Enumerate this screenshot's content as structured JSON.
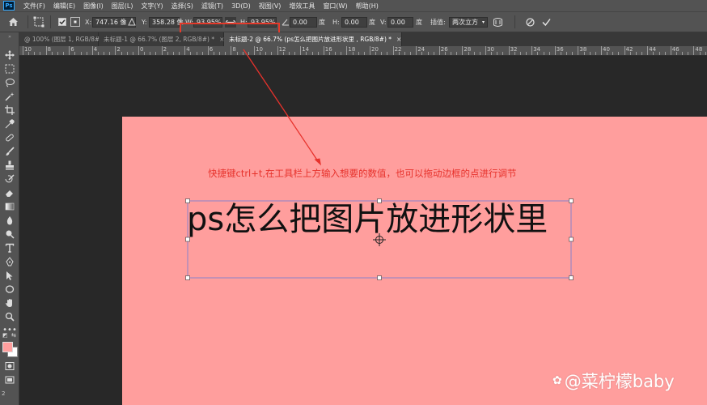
{
  "menubar": {
    "logo": "Ps",
    "items": [
      "文件(F)",
      "编辑(E)",
      "图像(I)",
      "图层(L)",
      "文字(Y)",
      "选择(S)",
      "滤镜(T)",
      "3D(D)",
      "视图(V)",
      "增效工具",
      "窗口(W)",
      "帮助(H)"
    ]
  },
  "options": {
    "x_label": "X:",
    "x_value": "747.16 像",
    "y_label": "Y:",
    "y_value": "358.28 像",
    "w_label": "W:",
    "w_value": "93.95%",
    "h_label": "H:",
    "h_value": "93.95%",
    "angle_value": "0.00",
    "angle_unit": "度",
    "hskew_label": "H:",
    "hskew_value": "0.00",
    "hskew_unit": "度",
    "vskew_label": "V:",
    "vskew_value": "0.00",
    "vskew_unit": "度",
    "interp_label": "插值:",
    "interp_value": "两次立方",
    "highlight_color": "#e53a2a"
  },
  "tabs": [
    {
      "label": "@ 100% (图层 1, RGB/8#)",
      "close": "×"
    },
    {
      "label": "未标题-1 @ 66.7% (图层 2, RGB/8#) *",
      "close": "×"
    },
    {
      "label": "未标题-2 @ 66.7% (ps怎么把图片放进形状里 , RGB/8#) *",
      "close": "×"
    }
  ],
  "ruler": {
    "labels": [
      "10",
      "8",
      "6",
      "4",
      "2",
      "0",
      "2",
      "4",
      "6",
      "8",
      "10",
      "12",
      "14",
      "16",
      "18",
      "20",
      "22",
      "24",
      "26",
      "28",
      "30",
      "32",
      "34",
      "36",
      "38",
      "40",
      "42",
      "44",
      "46",
      "48"
    ]
  },
  "canvas": {
    "background": "#ff9e9d",
    "annotation": "快捷键ctrl+t,在工具栏上方输入想要的数值，也可以拖动边框的点进行调节",
    "annotation_color": "#e7322c",
    "main_text": "ps怎么把图片放进形状里"
  },
  "watermark": {
    "icon": "菜柠檬-logo-icon",
    "text": "@菜柠檬baby"
  },
  "status": {
    "zoom_hint": "2"
  },
  "colors": {
    "foreground": "#ff9e9d",
    "background": "#ffffff"
  }
}
